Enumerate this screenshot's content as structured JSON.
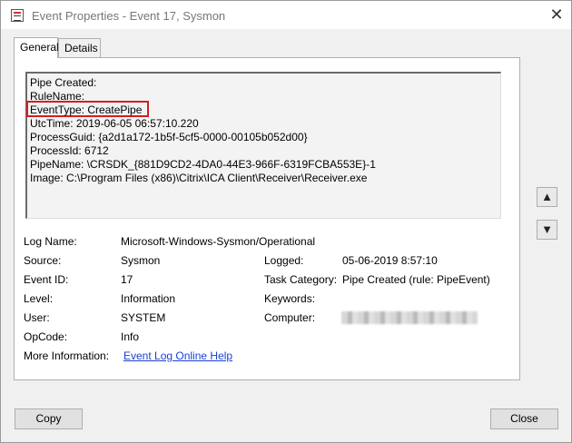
{
  "window": {
    "title": "Event Properties - Event 17, Sysmon"
  },
  "tabs": [
    {
      "label": "General"
    },
    {
      "label": "Details"
    }
  ],
  "event_text": [
    "Pipe Created:",
    "RuleName:",
    "EventType: CreatePipe",
    "UtcTime: 2019-06-05 06:57:10.220",
    "ProcessGuid: {a2d1a172-1b5f-5cf5-0000-00105b052d00}",
    "ProcessId: 6712",
    "PipeName: \\CRSDK_{881D9CD2-4DA0-44E3-966F-6319FCBA553E}-1",
    "Image: C:\\Program Files (x86)\\Citrix\\ICA Client\\Receiver\\Receiver.exe"
  ],
  "fields": {
    "log_name_label": "Log Name:",
    "log_name_value": "Microsoft-Windows-Sysmon/Operational",
    "source_label": "Source:",
    "source_value": "Sysmon",
    "logged_label": "Logged:",
    "logged_value": "05-06-2019 8:57:10",
    "event_id_label": "Event ID:",
    "event_id_value": "17",
    "task_category_label": "Task Category:",
    "task_category_value": "Pipe Created (rule: PipeEvent)",
    "level_label": "Level:",
    "level_value": "Information",
    "keywords_label": "Keywords:",
    "keywords_value": "",
    "user_label": "User:",
    "user_value": "SYSTEM",
    "computer_label": "Computer:",
    "opcode_label": "OpCode:",
    "opcode_value": "Info",
    "more_info_label": "More Information:",
    "more_info_link": "Event Log Online Help"
  },
  "buttons": {
    "copy": "Copy",
    "close": "Close"
  },
  "icons": {
    "up": "arrow-up-icon",
    "down": "arrow-down-icon",
    "close": "close-icon",
    "app": "event-viewer-icon"
  },
  "colors": {
    "highlight_border": "#d41f1f",
    "link": "#1a3fd1"
  }
}
